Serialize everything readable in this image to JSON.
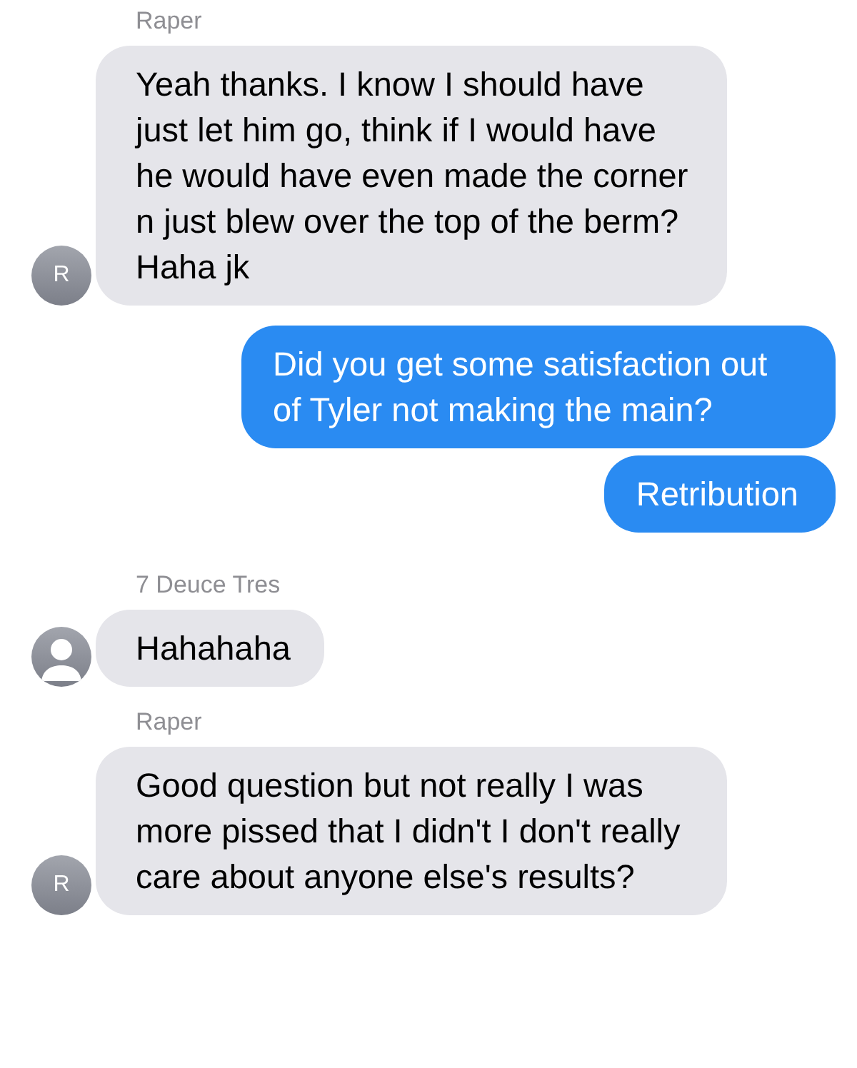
{
  "messages": [
    {
      "kind": "incoming",
      "sender": "Raper",
      "avatar": {
        "kind": "initial",
        "text": "R"
      },
      "text": "Yeah thanks. I know I should have just let him go, think if I would have he would have even made the corner n just blew over the top of the berm? Haha jk"
    },
    {
      "kind": "outgoing",
      "text": "Did you get some satisfaction out of Tyler not making the main?"
    },
    {
      "kind": "outgoing",
      "text": "Retribution"
    },
    {
      "kind": "incoming",
      "sender": "7 Deuce Tres",
      "avatar": {
        "kind": "silhouette"
      },
      "text": "Hahahaha"
    },
    {
      "kind": "incoming",
      "sender": "Raper",
      "avatar": {
        "kind": "initial",
        "text": "R"
      },
      "text": "Good question but not really I was more pissed that I didn't I don't really care about anyone else's results?"
    }
  ]
}
